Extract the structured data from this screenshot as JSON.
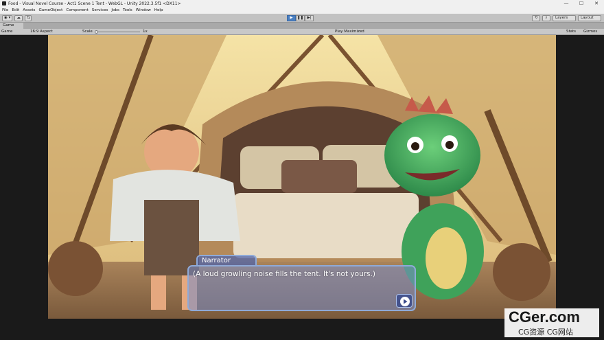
{
  "window": {
    "title": "Food - Visual Novel Course - Act1 Scene 1 Tent - WebGL - Unity 2022.3.5f1 <DX11>",
    "buttons": [
      "—",
      "☐",
      "✕"
    ]
  },
  "menu": [
    "File",
    "Edit",
    "Assets",
    "GameObject",
    "Component",
    "Services",
    "Jobs",
    "Tools",
    "Window",
    "Help"
  ],
  "toolbar": {
    "account_label": "◉ ▾",
    "cloud_label": "☁",
    "collab_label": "⇆",
    "play_icon": "▶",
    "pause_icon": "❚❚",
    "step_icon": "▶|",
    "layers_label": "Layers",
    "layout_label": "Layout"
  },
  "tab": {
    "label": "Game"
  },
  "gamebar": {
    "display_label": "Game",
    "aspect_label": "16:9 Aspect",
    "scale_label": "Scale",
    "scale_value": "1x",
    "play_mode_label": "Play Maximized",
    "stats_label": "Stats",
    "gizmos_label": "Gizmos"
  },
  "dialogue": {
    "speaker": "Narrator",
    "text": "(A loud growling noise fills the tent. It's not yours.)"
  },
  "watermark": {
    "line1": "CGer.com",
    "line2": "CG资源 CG网站"
  }
}
